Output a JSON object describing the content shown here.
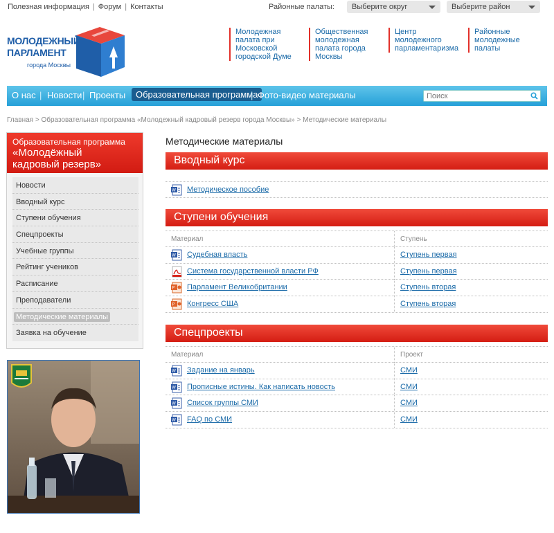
{
  "top": {
    "links": [
      "Полезная информация",
      "Форум",
      "Контакты"
    ],
    "district_label": "Районные палаты:",
    "okrug_select": "Выберите округ",
    "raion_select": "Выберите район"
  },
  "logo": {
    "line1": "МОЛОДЕЖНЫЙ",
    "line2": "ПАРЛАМЕНТ",
    "line3": "города Москвы"
  },
  "header_links": [
    "Молодежная палата при Московской городской Думе",
    "Общественная молодежная палата города Москвы",
    "Центр молодежного парламентаризма",
    "Районные молодежные палаты"
  ],
  "nav": {
    "items": [
      "О нас",
      "Новости",
      "Проекты",
      "Образовательная программа",
      "Фото-видео материалы"
    ],
    "active_index": 3,
    "search_placeholder": "Поиск"
  },
  "breadcrumb": {
    "home": "Главная",
    "program": "Образовательная программа «Молодежный кадровый резерв города Москвы»",
    "current": "Методические материалы",
    "sep": ">"
  },
  "sidebar": {
    "title_line1": "Образовательная программа",
    "title_line2": "«Молодёжный",
    "title_line3": "кадровый резерв»",
    "items": [
      "Новости",
      "Вводный курс",
      "Ступени обучения",
      "Спецпроекты",
      "Учебные группы",
      "Рейтинг учеников",
      "Расписание",
      "Преподаватели",
      "Методические материалы",
      "Заявка на обучение"
    ],
    "active_index": 8
  },
  "main": {
    "title": "Методические материалы",
    "intro": {
      "heading": "Вводный курс",
      "rows": [
        {
          "type": "doc",
          "name": "Методическое пособие"
        }
      ]
    },
    "stages": {
      "heading": "Ступени обучения",
      "col1": "Материал",
      "col2": "Ступень",
      "rows": [
        {
          "type": "doc",
          "name": "Судебная власть",
          "stage": "Ступень первая"
        },
        {
          "type": "pdf",
          "name": "Система государственной власти РФ",
          "stage": "Ступень первая"
        },
        {
          "type": "ppt",
          "name": "Парламент Великобритании",
          "stage": "Ступень вторая"
        },
        {
          "type": "ppt",
          "name": "Конгресс США",
          "stage": "Ступень вторая"
        }
      ]
    },
    "special": {
      "heading": "Спецпроекты",
      "col1": "Материал",
      "col2": "Проект",
      "rows": [
        {
          "type": "doc",
          "name": "Задание на январь",
          "stage": "СМИ"
        },
        {
          "type": "doc",
          "name": "Прописные истины. Как написать новость",
          "stage": "СМИ"
        },
        {
          "type": "doc",
          "name": "Список группы СМИ",
          "stage": "СМИ"
        },
        {
          "type": "doc",
          "name": "FAQ по СМИ",
          "stage": "СМИ"
        }
      ]
    }
  },
  "colors": {
    "brand_blue": "#1f5ea8",
    "nav_blue": "#26a0d8",
    "accent_red": "#e2302a",
    "link": "#1a6aa8"
  }
}
